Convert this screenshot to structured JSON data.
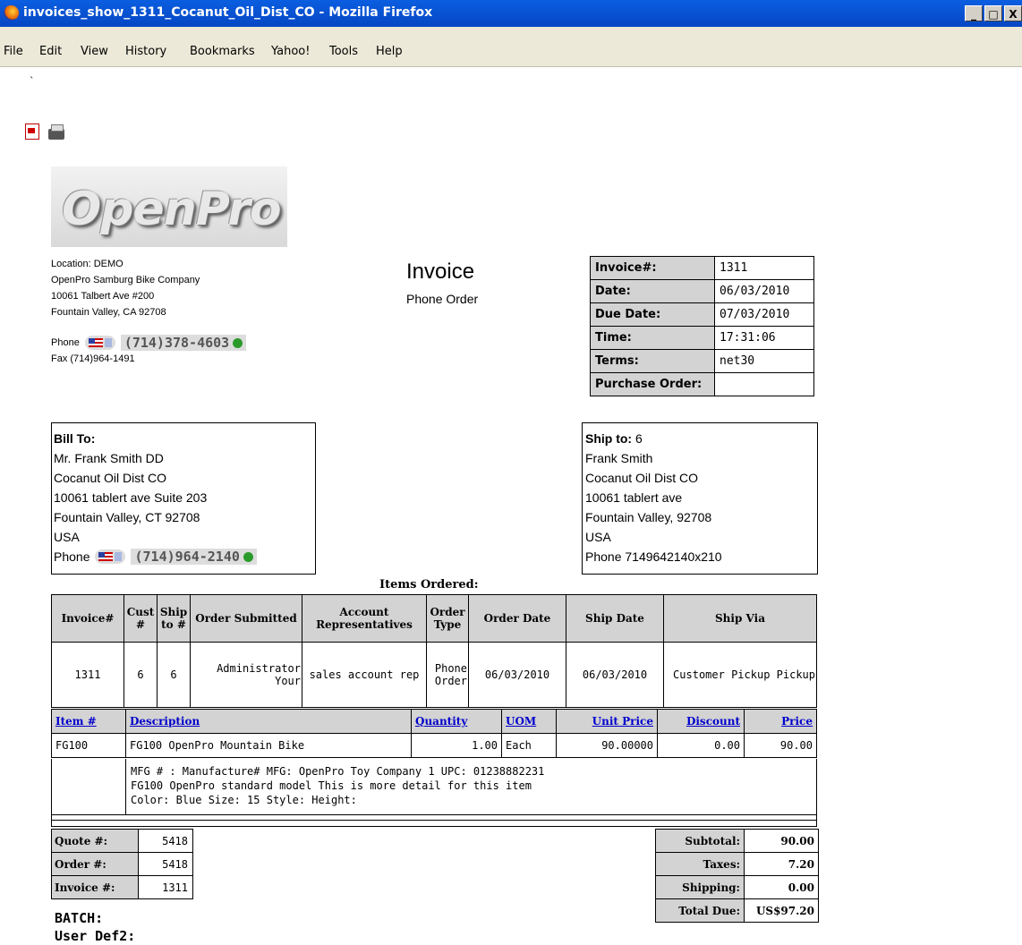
{
  "window": {
    "title": "invoices_show_1311_Cocanut_Oil_Dist_CO - Mozilla Firefox",
    "min": "_",
    "max": "□",
    "close": "X"
  },
  "menu": [
    "File",
    "Edit",
    "View",
    "History",
    "Bookmarks",
    "Yahoo!",
    "Tools",
    "Help"
  ],
  "tick": "`",
  "logo_text": "OpenPro",
  "company": {
    "location": "Location: DEMO",
    "name": "OpenPro Samburg Bike Company",
    "address1": "10061 Talbert Ave #200",
    "address2": "Fountain Valley, CA 92708",
    "phone_label": "Phone",
    "phone": "(714)378-4603",
    "fax": "Fax (714)964-1491"
  },
  "invoice": {
    "title": "Invoice",
    "subtitle": "Phone Order"
  },
  "meta": [
    {
      "label": "Invoice#:",
      "value": "1311"
    },
    {
      "label": "Date:",
      "value": "06/03/2010"
    },
    {
      "label": "Due Date:",
      "value": "07/03/2010"
    },
    {
      "label": "Time:",
      "value": "17:31:06"
    },
    {
      "label": "Terms:",
      "value": "net30"
    },
    {
      "label": "Purchase Order:",
      "value": ""
    }
  ],
  "bill_to": {
    "heading": "Bill To:",
    "lines": [
      "Mr. Frank Smith DD",
      "Cocanut Oil Dist CO",
      "10061 tablert ave Suite 203",
      "Fountain Valley, CT 92708",
      "USA"
    ],
    "phone_label": "Phone",
    "phone": "(714)964-2140"
  },
  "ship_to": {
    "heading": "Ship to:",
    "heading_value": "6",
    "lines": [
      "Frank Smith",
      "Cocanut Oil Dist CO",
      "10061 tablert ave",
      "Fountain Valley, 92708",
      "USA",
      "Phone 7149642140x210"
    ]
  },
  "items_ordered_title": "Items Ordered:",
  "order": {
    "headers": [
      "Invoice#",
      "Cust #",
      "Ship to #",
      "Order Submitted",
      "Account Representatives",
      "Order Type",
      "Order Date",
      "Ship Date",
      "Ship Via"
    ],
    "row": [
      "1311",
      "6",
      "6",
      "Administrator Your",
      "sales account rep",
      "Phone Order",
      "06/03/2010",
      "06/03/2010",
      "Customer Pickup Pickup"
    ]
  },
  "items": {
    "headers": [
      "Item #",
      "Description",
      "Quantity",
      "UOM",
      "Unit Price",
      "Discount",
      "Price"
    ],
    "row": [
      "FG100",
      "FG100 OpenPro Mountain Bike",
      "1.00",
      "Each",
      "90.00000",
      "0.00",
      "90.00"
    ],
    "detail": [
      "MFG # : Manufacture#  MFG: OpenPro Toy Company 1  UPC: 01238882231",
      "FG100 OpenPro standard model This is more detail for this item",
      "Color: Blue Size: 15 Style: Height:"
    ]
  },
  "quote": [
    {
      "label": "Quote #:",
      "value": "5418"
    },
    {
      "label": "Order #:",
      "value": "5418"
    },
    {
      "label": "Invoice #:",
      "value": "1311"
    }
  ],
  "totals": [
    {
      "label": "Subtotal:",
      "value": "90.00"
    },
    {
      "label": "Taxes:",
      "value": "7.20"
    },
    {
      "label": "Shipping:",
      "value": "0.00"
    },
    {
      "label": "Total Due:",
      "value": "US$97.20"
    }
  ],
  "footer": [
    "BATCH:",
    "User Def2:"
  ]
}
